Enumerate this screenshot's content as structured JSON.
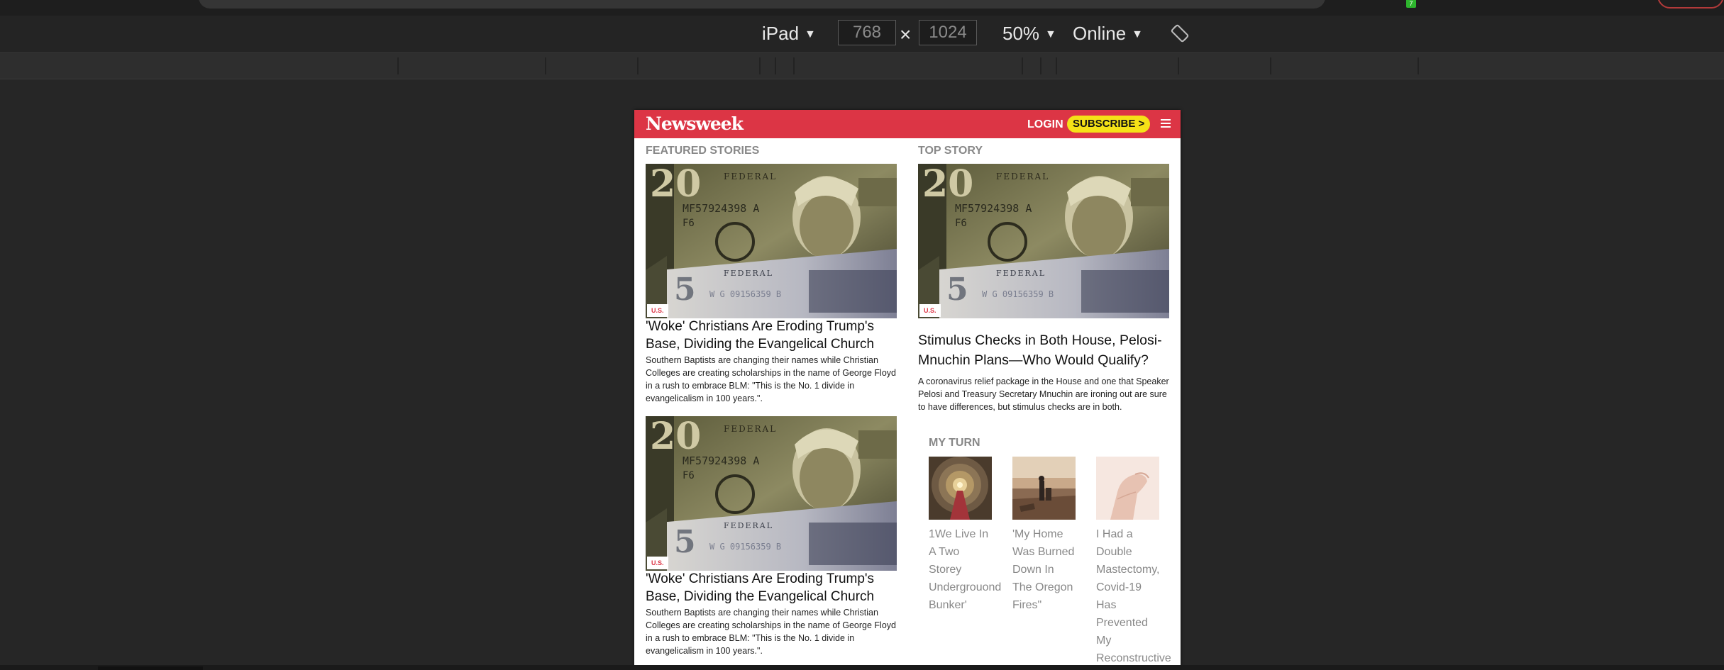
{
  "toolbar": {
    "device": "iPad",
    "width": "768",
    "height": "1024",
    "times": "×",
    "zoom": "50%",
    "network": "Online",
    "badge_count": "7"
  },
  "header": {
    "logo": "Newsweek",
    "login": "LOGIN",
    "subscribe": "SUBSCRIBE >"
  },
  "featured": {
    "label": "FEATURED STORIES",
    "stories": [
      {
        "tag": "U.S.",
        "headline": "'Woke' Christians Are Eroding Trump's Base, Dividing the Evangelical Church",
        "dek": "Southern Baptists are changing their names while Christian Colleges are creating scholarships in the name of George Floyd in a rush to embrace BLM: \"This is the No. 1 divide in evangelicalism in 100 years.\"."
      },
      {
        "tag": "U.S.",
        "headline": "'Woke' Christians Are Eroding Trump's Base, Dividing the Evangelical Church",
        "dek": "Southern Baptists are changing their names while Christian Colleges are creating scholarships in the name of George Floyd in a rush to embrace BLM: \"This is the No. 1 divide in evangelicalism in 100 years.\"."
      }
    ]
  },
  "top_story": {
    "label": "TOP STORY",
    "tag": "U.S.",
    "headline": "Stimulus Checks in Both House, Pelosi-Mnuchin Plans—Who Would Qualify?",
    "dek": "A coronavirus relief package in the House and one that Speaker Pelosi and Treasury Secretary Mnuchin are ironing out are sure to have differences, but stimulus checks are in both."
  },
  "my_turn": {
    "label": "MY TURN",
    "items": [
      {
        "title": "1We Live In A Two Storey Undergrouond Bunker'"
      },
      {
        "title": "'My Home Was Burned Down In The Oregon Fires\""
      },
      {
        "title": "I Had a Double Mastectomy, Covid-19 Has Prevented My Reconstructive"
      }
    ]
  },
  "colors": {
    "brand_red": "#dc3545",
    "subscribe_yellow": "#f5e217"
  }
}
